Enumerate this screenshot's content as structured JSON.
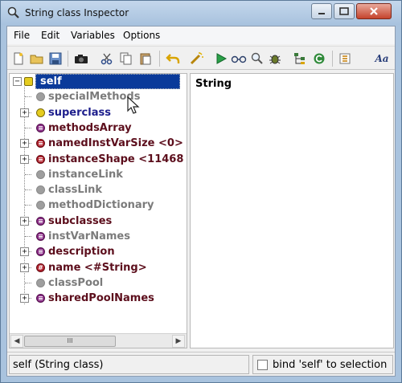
{
  "window": {
    "title": "String class Inspector"
  },
  "menu": [
    "File",
    "Edit",
    "Variables",
    "Options"
  ],
  "toolbar": {
    "icons": [
      "new-document-icon",
      "open-folder-icon",
      "save-icon",
      "camera-icon",
      "scissors-icon",
      "copy-icon",
      "paste-icon",
      "undo-icon",
      "wand-icon",
      "run-icon",
      "glasses-icon",
      "search-icon",
      "bug-icon",
      "tree-structure-icon",
      "refresh-icon",
      "properties-icon",
      "font-icon"
    ],
    "font_label": "Aa"
  },
  "tree": {
    "root": {
      "label": "self",
      "expander": "−"
    },
    "items": [
      {
        "label": "specialMethods",
        "icon": "gray",
        "style": "gray",
        "expander": ""
      },
      {
        "label": "superclass",
        "icon": "yellow",
        "style": "blue",
        "expander": "+"
      },
      {
        "label": "methodsArray",
        "icon": "purple",
        "style": "maroon",
        "expander": "",
        "icon_glyph": "≡"
      },
      {
        "label": "namedInstVarSize <0>",
        "icon": "red",
        "style": "maroon",
        "expander": "+",
        "icon_glyph": "≡"
      },
      {
        "label": "instanceShape <11468",
        "icon": "red",
        "style": "maroon",
        "expander": "+",
        "icon_glyph": "≡"
      },
      {
        "label": "instanceLink",
        "icon": "gray",
        "style": "gray",
        "expander": ""
      },
      {
        "label": "classLink",
        "icon": "gray",
        "style": "gray",
        "expander": ""
      },
      {
        "label": "methodDictionary",
        "icon": "gray",
        "style": "gray",
        "expander": ""
      },
      {
        "label": "subclasses",
        "icon": "purple",
        "style": "maroon",
        "expander": "+",
        "icon_glyph": "≡"
      },
      {
        "label": "instVarNames",
        "icon": "purple",
        "style": "gray",
        "expander": "",
        "icon_glyph": "≡"
      },
      {
        "label": "description",
        "icon": "purple",
        "style": "maroon",
        "expander": "+",
        "icon_glyph": "≡"
      },
      {
        "label": "name <#String>",
        "icon": "red",
        "style": "maroon",
        "expander": "+",
        "icon_glyph": "#"
      },
      {
        "label": "classPool",
        "icon": "gray",
        "style": "gray",
        "expander": ""
      },
      {
        "label": "sharedPoolNames",
        "icon": "purple",
        "style": "maroon",
        "expander": "+",
        "icon_glyph": "≡"
      }
    ]
  },
  "scrollbar": {
    "left_arrow": "◀",
    "right_arrow": "▶",
    "thumb_grip": "III"
  },
  "text_pane": {
    "content": "String"
  },
  "status": {
    "left_text": "self (String class)",
    "checkbox_label": "bind 'self' to selection",
    "checkbox_checked": false
  }
}
